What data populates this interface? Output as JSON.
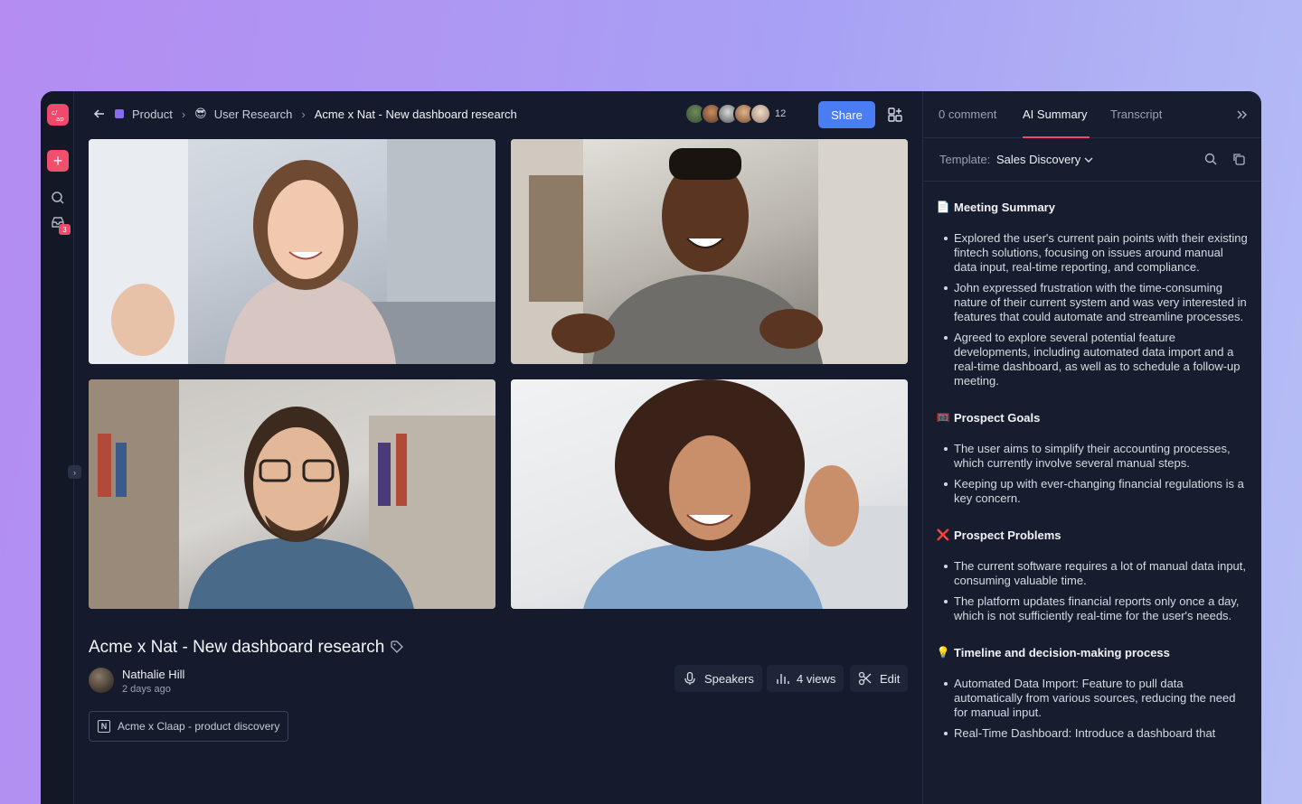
{
  "app": {
    "logo_icon": "claap-logo-icon",
    "brand_color": "#ef4a6b",
    "accent_color": "#4a7df3"
  },
  "rail": {
    "inbox_badge": "3"
  },
  "breadcrumb": {
    "items": [
      {
        "label": "Product",
        "icon": "purple-square-icon"
      },
      {
        "label": "User Research",
        "icon": "😎"
      },
      {
        "label": "Acme x Nat - New dashboard research"
      }
    ]
  },
  "participants": {
    "extra_count": "12"
  },
  "toolbar": {
    "share_label": "Share"
  },
  "video": {
    "title": "Acme x Nat - New dashboard research",
    "author": "Nathalie Hill",
    "time": "2 days ago",
    "speakers_label": "Speakers",
    "views_label": "4 views",
    "edit_label": "Edit",
    "doc_link": "Acme x Claap - product discovery"
  },
  "panel": {
    "tabs": [
      {
        "label": "0 comment"
      },
      {
        "label": "AI Summary",
        "active": true
      },
      {
        "label": "Transcript"
      }
    ],
    "template_label": "Template:",
    "template_value": "Sales Discovery",
    "sections": [
      {
        "icon": "📄",
        "title": "Meeting Summary",
        "bullets": [
          "Explored the user's current pain points with their existing fintech solutions, focusing on issues around manual data input, real-time reporting, and compliance.",
          "John expressed frustration with the time-consuming nature of their current system and was very interested in features that could automate and streamline processes.",
          "Agreed to explore several potential feature developments, including automated data import and a real-time dashboard, as well as to schedule a follow-up meeting."
        ]
      },
      {
        "icon": "🥅",
        "title": "Prospect Goals",
        "bullets": [
          "The user aims to simplify their accounting processes, which currently involve several manual steps.",
          "Keeping up with ever-changing financial regulations is a key concern."
        ]
      },
      {
        "icon": "❌",
        "title": "Prospect Problems",
        "bullets": [
          "The current software requires a lot of manual data input, consuming valuable time.",
          "The platform updates financial reports only once a day, which is not sufficiently real-time for the user's needs."
        ]
      },
      {
        "icon": "💡",
        "title": "Timeline and decision-making process",
        "bullets": [
          "Automated Data Import: Feature to pull data automatically from various sources, reducing the need for manual input.",
          "Real-Time Dashboard: Introduce a dashboard that"
        ]
      }
    ]
  }
}
